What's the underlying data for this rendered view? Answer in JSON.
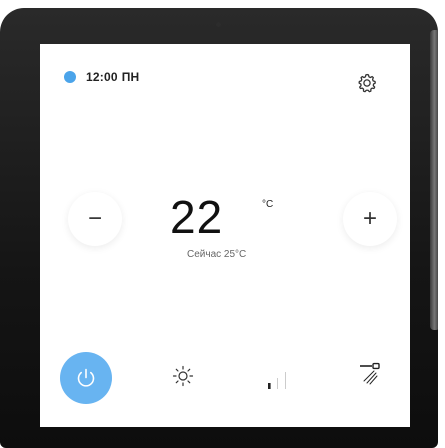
{
  "status": {
    "dot_color": "#4ba4ea",
    "time": "12:00",
    "day": "ПН"
  },
  "icons": {
    "settings": "gear-icon",
    "power": "power-icon",
    "mode": "sun-icon",
    "signal": "signal-bars-icon",
    "airflow": "airflow-icon"
  },
  "thermostat": {
    "minus_label": "−",
    "plus_label": "+",
    "target_value": "22",
    "unit": "°C",
    "current_label": "Сейчас 25°C"
  },
  "colors": {
    "accent": "#68b4f1",
    "bezel": "#151515",
    "screen": "#ffffff"
  }
}
